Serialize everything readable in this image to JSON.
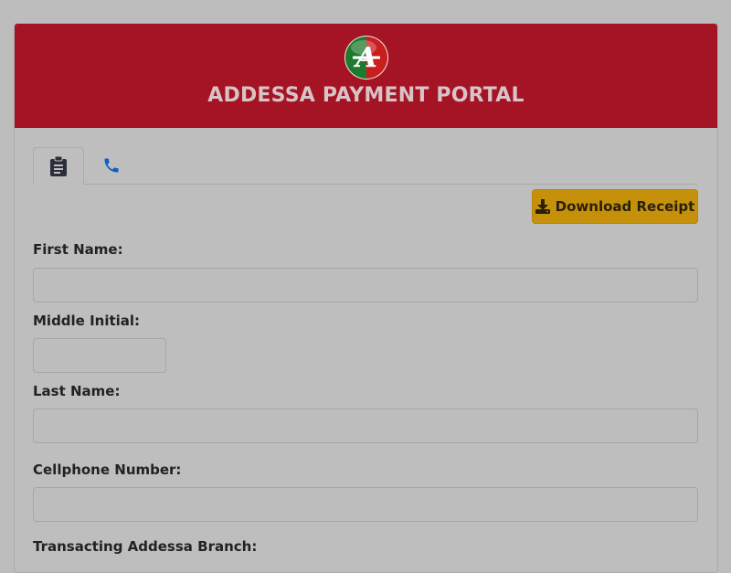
{
  "header": {
    "title": "ADDESSA PAYMENT PORTAL",
    "logo_letter": "A",
    "colors": {
      "banner": "#a51424",
      "logo_green": "#1f7a2e",
      "logo_red": "#c81e1e"
    }
  },
  "tabs": [
    {
      "icon": "clipboard-icon",
      "active": true
    },
    {
      "icon": "phone-icon",
      "active": false
    }
  ],
  "actions": {
    "download_label": "Download Receipt",
    "download_icon": "download-icon",
    "accent": "#c6910a"
  },
  "form": {
    "first_name_label": "First Name:",
    "first_name_value": "",
    "middle_initial_label": "Middle Initial:",
    "middle_initial_value": "",
    "last_name_label": "Last Name:",
    "last_name_value": "",
    "cellphone_label": "Cellphone Number:",
    "cellphone_value": "",
    "branch_label": "Transacting Addessa Branch:"
  }
}
